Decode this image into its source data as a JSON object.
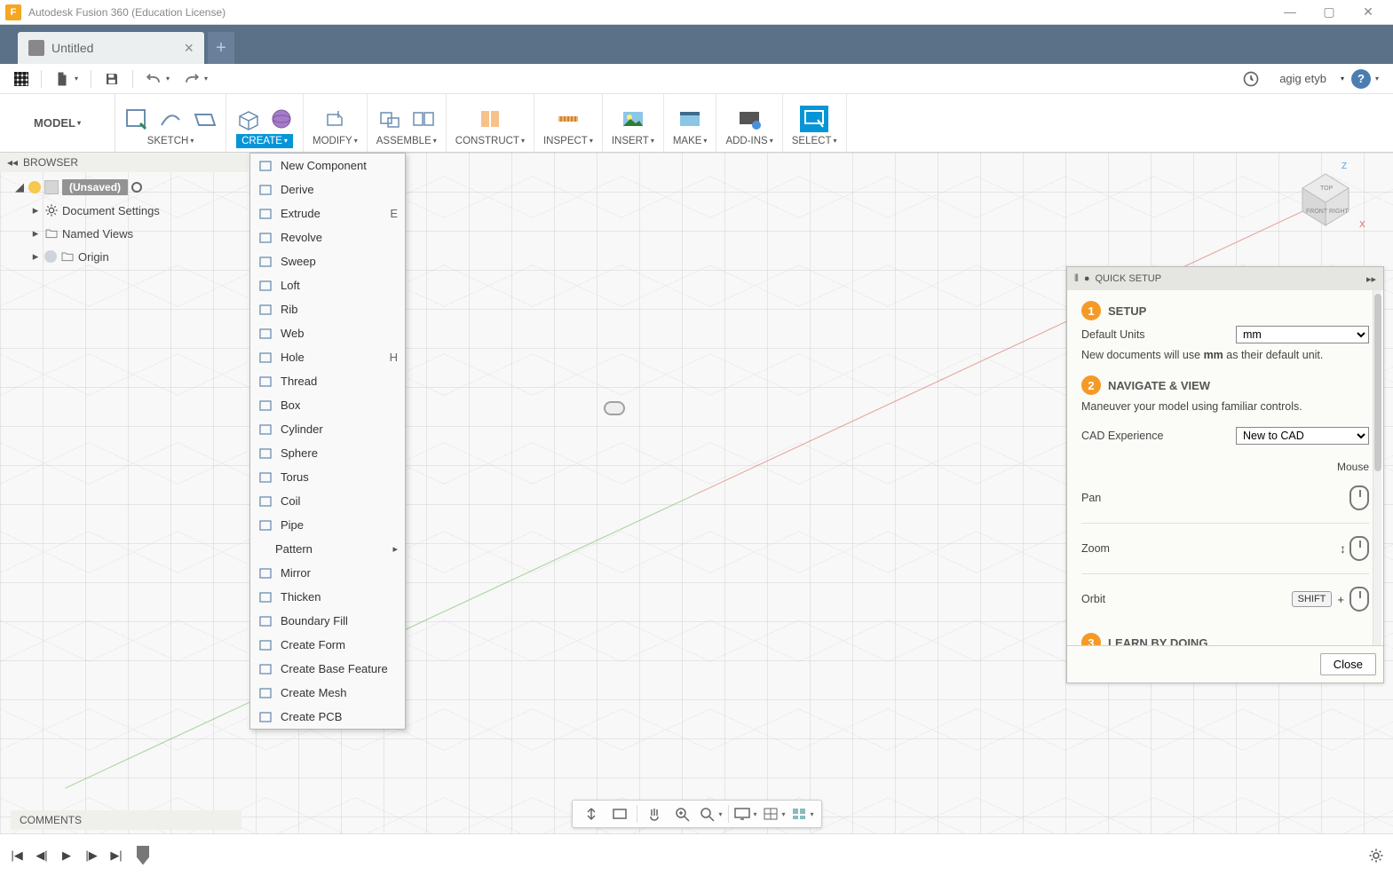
{
  "app": {
    "title": "Autodesk Fusion 360 (Education License)"
  },
  "window_controls": {
    "min": "—",
    "max": "▢",
    "close": "✕"
  },
  "doc_tabs": {
    "active": "Untitled"
  },
  "qat": {
    "undo_caret": "▾",
    "redo_caret": "▾",
    "file_caret": "▾",
    "username": "agig etyb"
  },
  "ribbon": {
    "workspace": "MODEL",
    "groups": [
      {
        "name": "SKETCH"
      },
      {
        "name": "CREATE",
        "active": true
      },
      {
        "name": "MODIFY"
      },
      {
        "name": "ASSEMBLE"
      },
      {
        "name": "CONSTRUCT"
      },
      {
        "name": "INSPECT"
      },
      {
        "name": "INSERT"
      },
      {
        "name": "MAKE"
      },
      {
        "name": "ADD-INS"
      },
      {
        "name": "SELECT"
      }
    ]
  },
  "browser": {
    "title": "BROWSER",
    "root": "(Unsaved)",
    "items": [
      {
        "label": "Document Settings"
      },
      {
        "label": "Named Views"
      },
      {
        "label": "Origin"
      }
    ]
  },
  "create_menu": [
    {
      "label": "New Component"
    },
    {
      "label": "Derive"
    },
    {
      "label": "Extrude",
      "shortcut": "E"
    },
    {
      "label": "Revolve"
    },
    {
      "label": "Sweep"
    },
    {
      "label": "Loft"
    },
    {
      "label": "Rib"
    },
    {
      "label": "Web"
    },
    {
      "label": "Hole",
      "shortcut": "H"
    },
    {
      "label": "Thread"
    },
    {
      "label": "Box"
    },
    {
      "label": "Cylinder"
    },
    {
      "label": "Sphere"
    },
    {
      "label": "Torus"
    },
    {
      "label": "Coil"
    },
    {
      "label": "Pipe"
    },
    {
      "label": "Pattern",
      "submenu": true
    },
    {
      "label": "Mirror"
    },
    {
      "label": "Thicken"
    },
    {
      "label": "Boundary Fill"
    },
    {
      "label": "Create Form"
    },
    {
      "label": "Create Base Feature"
    },
    {
      "label": "Create Mesh"
    },
    {
      "label": "Create PCB"
    }
  ],
  "viewcube": {
    "top": "TOP",
    "front": "FRONT",
    "right": "RIGHT",
    "x": "X",
    "z": "Z"
  },
  "quick_setup": {
    "title": "QUICK SETUP",
    "step1": {
      "heading": "SETUP",
      "units_label": "Default Units",
      "units_value": "mm",
      "hint_pre": "New documents will use ",
      "hint_bold": "mm",
      "hint_post": " as their default unit."
    },
    "step2": {
      "heading": "NAVIGATE & VIEW",
      "hint": "Maneuver your model using familiar controls.",
      "exp_label": "CAD Experience",
      "exp_value": "New to CAD",
      "mouse_hdr": "Mouse",
      "pan": "Pan",
      "zoom": "Zoom",
      "orbit": "Orbit",
      "shift_key": "SHIFT",
      "plus": "+"
    },
    "step3": {
      "heading": "LEARN BY DOING"
    },
    "close": "Close"
  },
  "comments": {
    "label": "COMMENTS"
  }
}
